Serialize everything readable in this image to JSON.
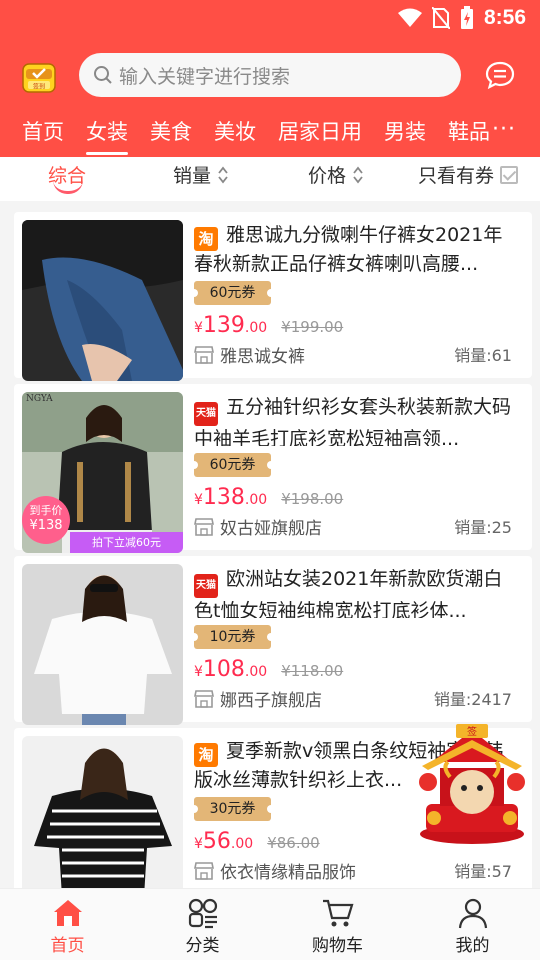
{
  "status": {
    "time": "8:56",
    "icons": [
      "wifi-icon",
      "no-sim-icon",
      "battery-charging-icon"
    ]
  },
  "header": {
    "sign_label": "签到",
    "search": {
      "placeholder": "输入关键字进行搜索"
    },
    "categories": [
      "首页",
      "女装",
      "美食",
      "美妆",
      "居家日用",
      "男装",
      "鞋品"
    ],
    "active_category": "女装",
    "more_label": "···"
  },
  "sortbar": {
    "items": [
      "综合",
      "销量",
      "价格"
    ],
    "active": "综合",
    "coupon_only_label": "只看有券"
  },
  "products": [
    {
      "platform": "淘",
      "title": "雅思诚九分微喇牛仔裤女2021年春秋新款正品仔裤女裤喇叭高腰...",
      "coupon": "60元券",
      "price_symbol": "¥",
      "price_int": "139",
      "price_dec": ".00",
      "original": "¥199.00",
      "shop": "雅思诚女裤",
      "sales": "销量:61"
    },
    {
      "platform": "天猫",
      "title": "五分袖针织衫女套头秋装新款大码中袖羊毛打底衫宽松短袖高领...",
      "coupon": "60元券",
      "price_symbol": "¥",
      "price_int": "138",
      "price_dec": ".00",
      "original": "¥198.00",
      "shop": "奴古娅旗舰店",
      "sales": "销量:25",
      "image_badge": {
        "label": "到手价",
        "price": "¥138",
        "strip": "拍下立减60元",
        "brand": "NGYA"
      }
    },
    {
      "platform": "天猫",
      "title": "欧洲站女装2021年新款欧货潮白色t恤女短袖纯棉宽松打底衫体...",
      "coupon": "10元券",
      "price_symbol": "¥",
      "price_int": "108",
      "price_dec": ".00",
      "original": "¥118.00",
      "shop": "娜西子旗舰店",
      "sales": "销量:2417"
    },
    {
      "platform": "淘",
      "title": "夏季新款v领黑白条纹短袖宽松韩版冰丝薄款针织衫上衣...",
      "coupon": "30元券",
      "price_symbol": "¥",
      "price_int": "56",
      "price_dec": ".00",
      "original": "¥86.00",
      "shop": "依衣情缘精品服饰",
      "sales": "销量:57"
    }
  ],
  "festive_banner": {
    "sign_text": "签"
  },
  "bottom_nav": [
    {
      "label": "首页",
      "icon": "home-icon",
      "active": true
    },
    {
      "label": "分类",
      "icon": "category-icon"
    },
    {
      "label": "购物车",
      "icon": "cart-icon"
    },
    {
      "label": "我的",
      "icon": "profile-icon"
    }
  ],
  "colors": {
    "brand": "#ff4f45",
    "price": "#ff2b4f",
    "coupon": "#e3b677"
  }
}
